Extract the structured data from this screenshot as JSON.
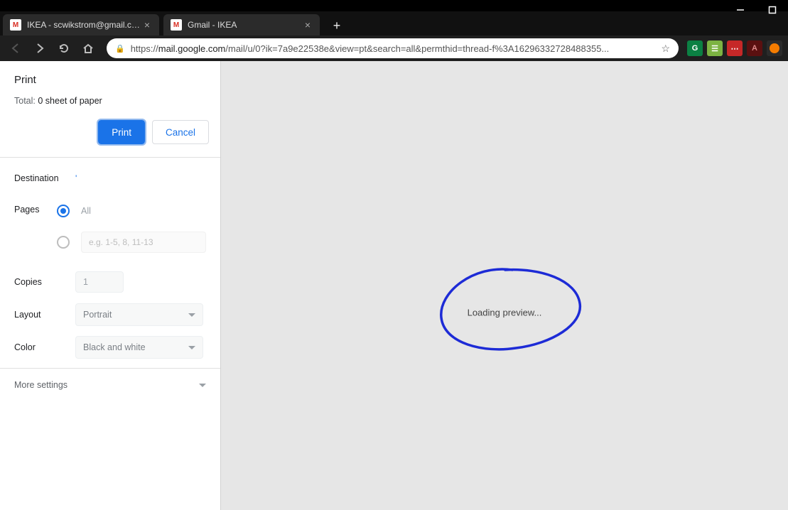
{
  "window": {
    "tabs": [
      {
        "title": "IKEA - scwikstrom@gmail.com - G"
      },
      {
        "title": "Gmail - IKEA"
      }
    ],
    "url_display_prefix": "https://",
    "url_display_host": "mail.google.com",
    "url_display_path": "/mail/u/0?ik=7a9e22538e&view=pt&search=all&permthid=thread-f%3A16296332728488355..."
  },
  "print": {
    "title": "Print",
    "total_label": "Total: ",
    "total_value": "0 sheet of paper",
    "print_btn": "Print",
    "cancel_btn": "Cancel",
    "destination_label": "Destination",
    "destination_value": "'",
    "pages_label": "Pages",
    "pages_all": "All",
    "pages_custom_placeholder": "e.g. 1-5, 8, 11-13",
    "copies_label": "Copies",
    "copies_value": "1",
    "layout_label": "Layout",
    "layout_value": "Portrait",
    "color_label": "Color",
    "color_value": "Black and white",
    "more_settings": "More settings"
  },
  "preview": {
    "loading": "Loading preview..."
  }
}
